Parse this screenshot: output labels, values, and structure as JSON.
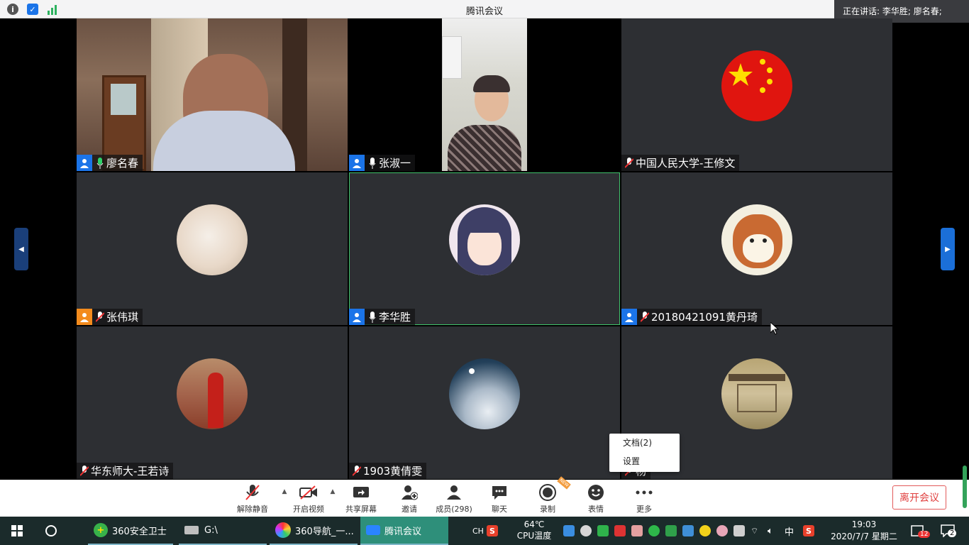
{
  "window": {
    "title": "腾讯会议",
    "speaking_label": "正在讲话: 李华胜; 廖名春;"
  },
  "participants": [
    {
      "name": "廖名春",
      "role": "host",
      "muted": false
    },
    {
      "name": "张淑一",
      "role": "host",
      "muted": false
    },
    {
      "name": "中国人民大学-王修文",
      "role": "none",
      "muted": true
    },
    {
      "name": "张伟琪",
      "role": "cohost",
      "muted": true
    },
    {
      "name": "李华胜",
      "role": "host",
      "muted": false
    },
    {
      "name": "20180421091黄丹琦",
      "role": "host",
      "muted": true
    },
    {
      "name": "华东师大-王若诗",
      "role": "none",
      "muted": true
    },
    {
      "name": "1903黄倩雯",
      "role": "none",
      "muted": true
    },
    {
      "name": "杨",
      "role": "none",
      "muted": true
    }
  ],
  "toolbar": {
    "unmute": "解除静音",
    "start_video": "开启视频",
    "share_screen": "共享屏幕",
    "invite": "邀请",
    "members": "成员(298)",
    "chat": "聊天",
    "record": "录制",
    "reactions": "表情",
    "more": "更多",
    "leave": "离开会议",
    "new_badge": "NEW"
  },
  "more_menu": {
    "documents": "文档(2)",
    "settings": "设置"
  },
  "taskbar": {
    "apps": [
      {
        "label": "360安全卫士"
      },
      {
        "label": "G:\\"
      },
      {
        "label": "360导航_一..."
      },
      {
        "label": "腾讯会议"
      }
    ],
    "temp_value": "64℃",
    "temp_label": "CPU温度",
    "ime": "中",
    "time": "19:03",
    "date": "2020/7/7 星期二",
    "notif_count": "12",
    "msg_count": "2",
    "ch_label": "CH"
  },
  "colors": {
    "host_badge": "#1b74e8",
    "cohost_badge": "#f38b1d",
    "leave_red": "#e0403f",
    "active_border": "#3fc06a"
  }
}
